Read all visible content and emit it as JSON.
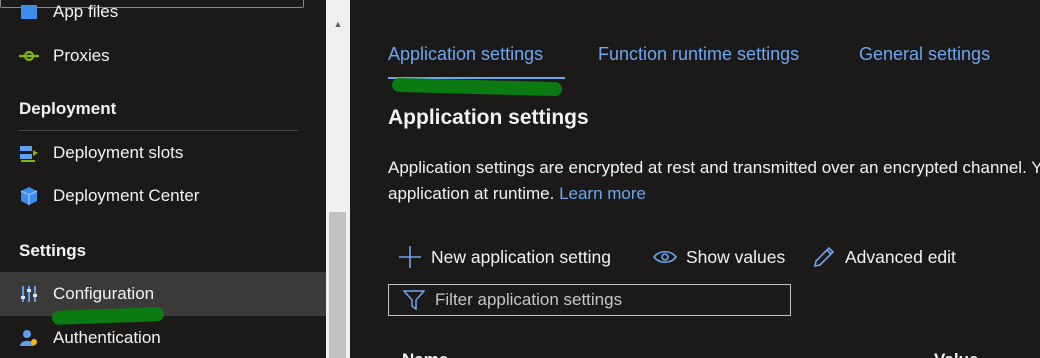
{
  "sidebar": {
    "top_item_label": "App files",
    "items": [
      {
        "label": "Proxies",
        "icon": "proxy-icon"
      },
      {
        "label": "Deployment slots",
        "icon": "deployment-slots-icon"
      },
      {
        "label": "Deployment Center",
        "icon": "deployment-center-icon"
      },
      {
        "label": "Configuration",
        "icon": "configuration-icon"
      },
      {
        "label": "Authentication",
        "icon": "authentication-icon"
      }
    ],
    "sections": {
      "deployment": "Deployment",
      "settings": "Settings"
    },
    "active_item": "Configuration"
  },
  "main": {
    "tabs": [
      {
        "label": "Application settings",
        "selected": true
      },
      {
        "label": "Function runtime settings",
        "selected": false
      },
      {
        "label": "General settings",
        "selected": false
      }
    ],
    "section_title": "Application settings",
    "description_line1": "Application settings are encrypted at rest and transmitted over an encrypted channel. You can choose to display them in plain text in your browser by using the controls below. Application Settings are exposed as environment variables for access by your",
    "description_line2_prefix": "application at runtime.",
    "learn_more": "Learn more",
    "toolbar": {
      "new_setting": "New application setting",
      "show_values": "Show values",
      "advanced_edit": "Advanced edit"
    },
    "filter_placeholder": "Filter application settings",
    "columns": {
      "name": "Name",
      "value": "Value"
    }
  },
  "colors": {
    "background": "#1b1a19",
    "accent": "#6ca6f0",
    "active_row": "#3b3a39",
    "annotation_green": "#0c7a12"
  }
}
